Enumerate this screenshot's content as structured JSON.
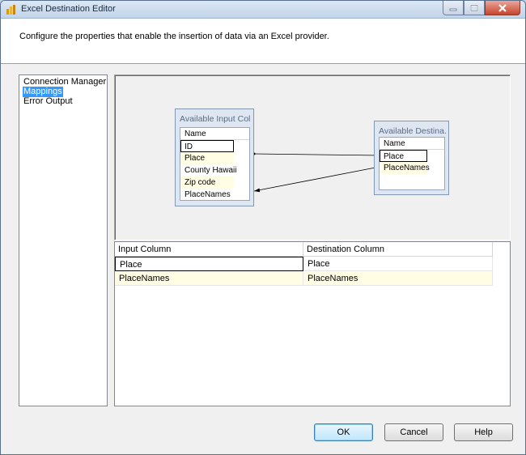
{
  "window": {
    "title": "Excel Destination Editor"
  },
  "header": {
    "text": "Configure the properties that enable the insertion of data via an Excel provider."
  },
  "sidebar": {
    "items": [
      {
        "label": "Connection Manager",
        "selected": false
      },
      {
        "label": "Mappings",
        "selected": true
      },
      {
        "label": "Error Output",
        "selected": false
      }
    ]
  },
  "input_table": {
    "title": "Available Input Col...",
    "column_header": "Name",
    "rows": [
      "ID",
      "Place",
      "County Hawaii",
      "Zip code",
      "PlaceNames"
    ]
  },
  "dest_table": {
    "title": "Available Destina...",
    "column_header": "Name",
    "rows": [
      "Place",
      "PlaceNames"
    ]
  },
  "mappings_grid": {
    "headers": [
      "Input Column",
      "Destination Column"
    ],
    "rows": [
      {
        "input": "Place",
        "destination": "Place"
      },
      {
        "input": "PlaceNames",
        "destination": "PlaceNames"
      }
    ]
  },
  "buttons": {
    "ok": "OK",
    "cancel": "Cancel",
    "help": "Help"
  },
  "colors": {
    "selection": "#3399ff",
    "alt_row": "#fffde4",
    "table_box": "#dde6f1"
  }
}
